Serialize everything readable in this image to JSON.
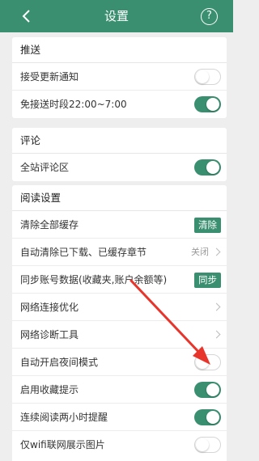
{
  "header": {
    "title": "设置",
    "help_glyph": "?"
  },
  "sections": {
    "push": {
      "title": "推送",
      "items": [
        {
          "label": "接受更新通知",
          "toggle": "off"
        },
        {
          "label": "免接送时段22:00~7:00",
          "toggle": "on"
        }
      ]
    },
    "comments": {
      "title": "评论",
      "items": [
        {
          "label": "全站评论区",
          "toggle": "on"
        }
      ]
    },
    "reading": {
      "title": "阅读设置",
      "items": [
        {
          "label": "清除全部缓存",
          "button": "清除"
        },
        {
          "label": "自动清除已下载、已缓存章节",
          "value": "关闭"
        },
        {
          "label": "同步账号数据(收藏夹,账户余额等)",
          "button": "同步"
        },
        {
          "label": "网络连接优化"
        },
        {
          "label": "网络诊断工具"
        },
        {
          "label": "自动开启夜间模式",
          "toggle": "off"
        },
        {
          "label": "启用收藏提示",
          "toggle": "on"
        },
        {
          "label": "连续阅读两小时提醒",
          "toggle": "on"
        },
        {
          "label": "仅wifi联网展示图片",
          "toggle": "off"
        }
      ]
    }
  },
  "colors": {
    "accent": "#3a8f70",
    "annotation_arrow": "#e8352c"
  }
}
